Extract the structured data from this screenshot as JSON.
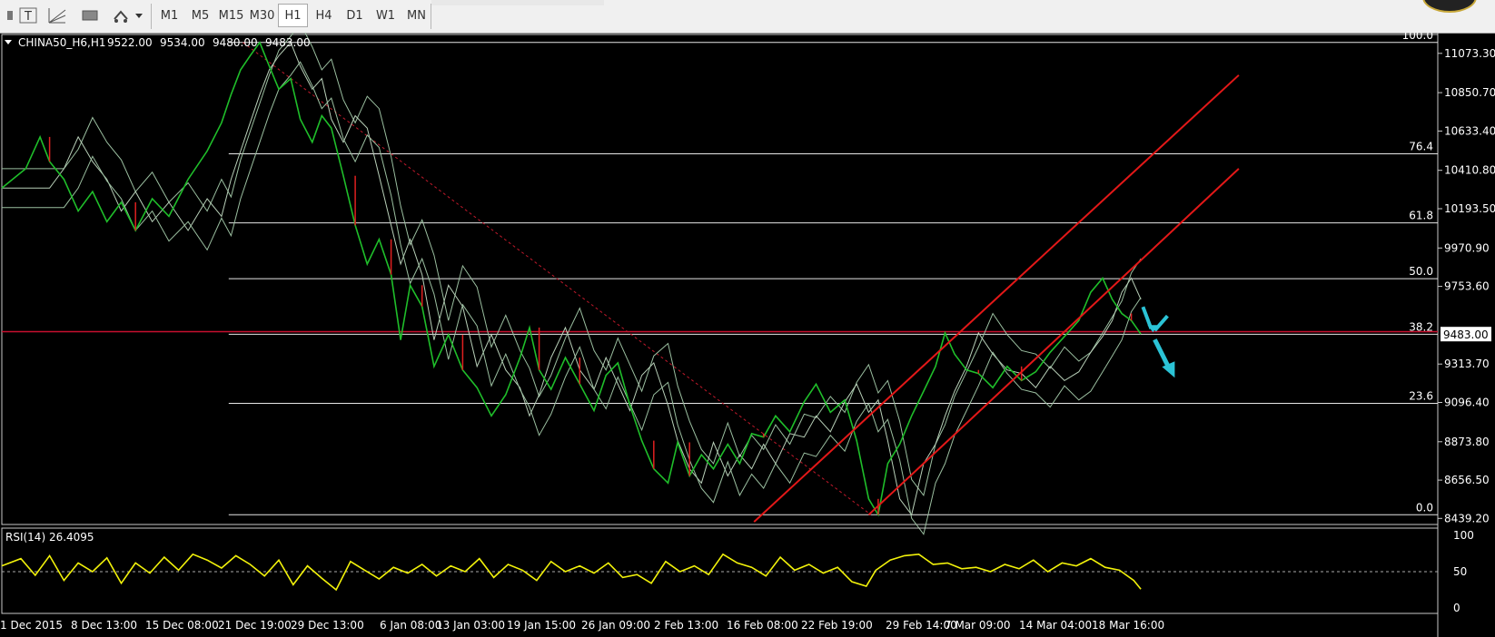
{
  "toolbar": {
    "timeframes": [
      "M1",
      "M5",
      "M15",
      "M30",
      "H1",
      "H4",
      "D1",
      "W1",
      "MN"
    ],
    "active_timeframe": "H1",
    "icons": [
      "text-label-icon",
      "fibonacci-fan-icon",
      "rectangle-icon",
      "arrows-icon",
      "dropdown-arrow-icon"
    ]
  },
  "chart_data": [
    {
      "type": "line",
      "title": "CHINA50_H6,H1",
      "header": {
        "symbol": "CHINA50_H6,H1",
        "open": "9522.00",
        "high": "9534.00",
        "low": "9480.00",
        "close": "9483.00"
      },
      "x_ticks": [
        "1 Dec 2015",
        "8 Dec 13:00",
        "15 Dec 08:00",
        "21 Dec 19:00",
        "29 Dec 13:00",
        "6 Jan 08:00",
        "13 Jan 03:00",
        "19 Jan 15:00",
        "26 Jan 09:00",
        "2 Feb 13:00",
        "16 Feb 08:00",
        "22 Feb 19:00",
        "29 Feb 14:00",
        "7 Mar 09:00",
        "14 Mar 04:00",
        "18 Mar 16:00"
      ],
      "y_ticks": [
        11073.3,
        10850.7,
        10633.4,
        10410.8,
        10193.5,
        9970.9,
        9753.6,
        9313.7,
        9096.4,
        8873.8,
        8656.5,
        8439.2
      ],
      "y_tick_labels": [
        "11073.30",
        "10850.70",
        "10633.40",
        "10410.80",
        "10193.50",
        "9970.90",
        "9753.60",
        "9313.70",
        "9096.40",
        "8873.80",
        "8656.50",
        "8439.20"
      ],
      "ylim": [
        8405,
        11180
      ],
      "current_price": 9483.0,
      "current_price_label": "9483.00",
      "fibonacci": {
        "high": 11135,
        "low": 8460,
        "levels": [
          {
            "label": "100.0",
            "value": 11135
          },
          {
            "label": "76.4",
            "value": 10504
          },
          {
            "label": "61.8",
            "value": 10113
          },
          {
            "label": "50.0",
            "value": 9797
          },
          {
            "label": "38.2",
            "value": 9482
          },
          {
            "label": "23.6",
            "value": 9091
          },
          {
            "label": "0.0",
            "value": 8460
          }
        ]
      },
      "price_series": [
        [
          0,
          10310
        ],
        [
          10,
          10420
        ],
        [
          16,
          10600
        ],
        [
          20,
          10460
        ],
        [
          26,
          10360
        ],
        [
          32,
          10180
        ],
        [
          38,
          10290
        ],
        [
          44,
          10120
        ],
        [
          50,
          10230
        ],
        [
          56,
          10070
        ],
        [
          63,
          10250
        ],
        [
          70,
          10150
        ],
        [
          78,
          10360
        ],
        [
          86,
          10520
        ],
        [
          92,
          10680
        ],
        [
          96,
          10840
        ],
        [
          100,
          10980
        ],
        [
          104,
          11060
        ],
        [
          108,
          11135
        ],
        [
          112,
          11000
        ],
        [
          116,
          10870
        ],
        [
          121,
          10930
        ],
        [
          125,
          10700
        ],
        [
          130,
          10570
        ],
        [
          134,
          10720
        ],
        [
          138,
          10650
        ],
        [
          143,
          10380
        ],
        [
          148,
          10100
        ],
        [
          153,
          9880
        ],
        [
          158,
          10020
        ],
        [
          163,
          9820
        ],
        [
          167,
          9450
        ],
        [
          171,
          9760
        ],
        [
          176,
          9640
        ],
        [
          181,
          9300
        ],
        [
          187,
          9480
        ],
        [
          193,
          9280
        ],
        [
          199,
          9180
        ],
        [
          205,
          9020
        ],
        [
          211,
          9140
        ],
        [
          217,
          9350
        ],
        [
          221,
          9520
        ],
        [
          225,
          9280
        ],
        [
          230,
          9170
        ],
        [
          236,
          9350
        ],
        [
          242,
          9200
        ],
        [
          248,
          9050
        ],
        [
          253,
          9250
        ],
        [
          258,
          9320
        ],
        [
          263,
          9080
        ],
        [
          268,
          8880
        ],
        [
          273,
          8720
        ],
        [
          279,
          8640
        ],
        [
          283,
          8870
        ],
        [
          288,
          8680
        ],
        [
          293,
          8800
        ],
        [
          298,
          8720
        ],
        [
          304,
          8860
        ],
        [
          309,
          8750
        ],
        [
          314,
          8920
        ],
        [
          319,
          8900
        ],
        [
          324,
          9020
        ],
        [
          330,
          8930
        ],
        [
          336,
          9100
        ],
        [
          341,
          9200
        ],
        [
          347,
          9040
        ],
        [
          353,
          9110
        ],
        [
          358,
          8880
        ],
        [
          363,
          8550
        ],
        [
          367,
          8460
        ],
        [
          371,
          8750
        ],
        [
          376,
          8860
        ],
        [
          381,
          9020
        ],
        [
          386,
          9160
        ],
        [
          391,
          9300
        ],
        [
          395,
          9490
        ],
        [
          399,
          9370
        ],
        [
          404,
          9280
        ],
        [
          409,
          9260
        ],
        [
          415,
          9180
        ],
        [
          421,
          9300
        ],
        [
          427,
          9220
        ],
        [
          433,
          9270
        ],
        [
          439,
          9380
        ],
        [
          445,
          9470
        ],
        [
          451,
          9560
        ],
        [
          456,
          9720
        ],
        [
          461,
          9800
        ],
        [
          465,
          9680
        ],
        [
          469,
          9600
        ],
        [
          473,
          9560
        ],
        [
          477,
          9483
        ]
      ],
      "channel": {
        "upper": [
          [
            315,
            8420
          ],
          [
            518,
            10950
          ]
        ],
        "lower": [
          [
            363,
            8460
          ],
          [
            518,
            10420
          ]
        ]
      },
      "diagonal_dotted": [
        [
          101,
          11135
        ],
        [
          364,
          8460
        ]
      ],
      "horizontal_red_line": 9497
    },
    {
      "type": "line",
      "title": "RSI(14) 26.4095",
      "indicator": "RSI(14)",
      "value": 26.4095,
      "ylim": [
        0,
        100
      ],
      "y_ticks": [
        100,
        50,
        0
      ],
      "y_tick_labels": [
        "100",
        "50",
        "0"
      ],
      "reference_level": 50,
      "rsi_series": [
        [
          0,
          58
        ],
        [
          8,
          68
        ],
        [
          14,
          45
        ],
        [
          20,
          72
        ],
        [
          26,
          38
        ],
        [
          32,
          62
        ],
        [
          38,
          50
        ],
        [
          44,
          69
        ],
        [
          50,
          34
        ],
        [
          56,
          62
        ],
        [
          62,
          48
        ],
        [
          68,
          70
        ],
        [
          74,
          52
        ],
        [
          80,
          74
        ],
        [
          86,
          66
        ],
        [
          92,
          55
        ],
        [
          98,
          72
        ],
        [
          104,
          60
        ],
        [
          110,
          44
        ],
        [
          116,
          66
        ],
        [
          122,
          32
        ],
        [
          128,
          58
        ],
        [
          134,
          41
        ],
        [
          140,
          25
        ],
        [
          146,
          64
        ],
        [
          152,
          52
        ],
        [
          158,
          40
        ],
        [
          164,
          56
        ],
        [
          170,
          48
        ],
        [
          176,
          60
        ],
        [
          182,
          44
        ],
        [
          188,
          58
        ],
        [
          194,
          50
        ],
        [
          200,
          68
        ],
        [
          206,
          42
        ],
        [
          212,
          60
        ],
        [
          218,
          52
        ],
        [
          224,
          38
        ],
        [
          230,
          64
        ],
        [
          236,
          50
        ],
        [
          242,
          58
        ],
        [
          248,
          48
        ],
        [
          254,
          62
        ],
        [
          260,
          42
        ],
        [
          266,
          46
        ],
        [
          272,
          34
        ],
        [
          278,
          64
        ],
        [
          284,
          50
        ],
        [
          290,
          58
        ],
        [
          296,
          46
        ],
        [
          302,
          74
        ],
        [
          308,
          62
        ],
        [
          314,
          56
        ],
        [
          320,
          44
        ],
        [
          326,
          70
        ],
        [
          332,
          52
        ],
        [
          338,
          60
        ],
        [
          344,
          48
        ],
        [
          350,
          56
        ],
        [
          356,
          36
        ],
        [
          362,
          30
        ],
        [
          366,
          52
        ],
        [
          372,
          66
        ],
        [
          378,
          72
        ],
        [
          384,
          74
        ],
        [
          390,
          60
        ],
        [
          396,
          62
        ],
        [
          402,
          54
        ],
        [
          408,
          56
        ],
        [
          414,
          50
        ],
        [
          420,
          60
        ],
        [
          426,
          54
        ],
        [
          432,
          66
        ],
        [
          438,
          50
        ],
        [
          444,
          62
        ],
        [
          450,
          58
        ],
        [
          456,
          68
        ],
        [
          462,
          56
        ],
        [
          468,
          52
        ],
        [
          474,
          38
        ],
        [
          477,
          26
        ]
      ]
    }
  ]
}
